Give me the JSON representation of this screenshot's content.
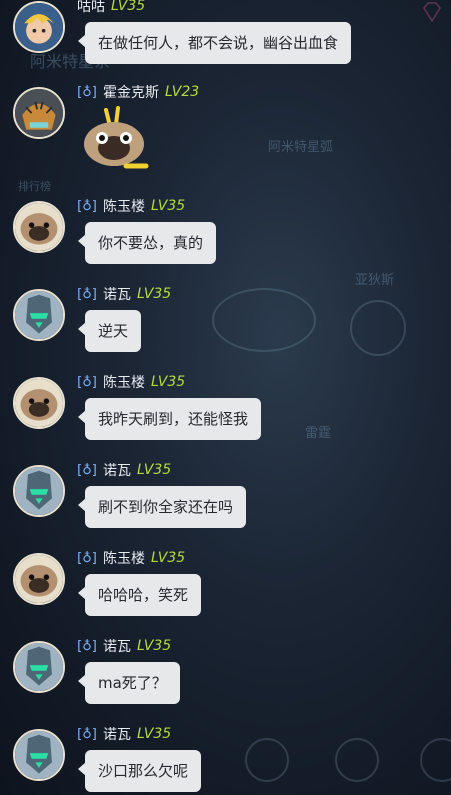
{
  "background": {
    "map_label_1": "阿米特星弧",
    "map_label_2": "亚狄斯",
    "map_label_3": "雷霆",
    "map_label_4": "排行榜",
    "map_label_5": "阿米特星系"
  },
  "messages": [
    {
      "name": "咕咕",
      "level": "LV35",
      "text": "在做任何人，都不会说，幽谷出血食",
      "avatar": "blonde-warrior-avatar",
      "vip": false
    },
    {
      "name": "霍金克斯",
      "level": "LV23",
      "text": "",
      "sticker": "pug-sticker",
      "avatar": "tiger-mech-avatar",
      "vip": true
    },
    {
      "name": "陈玉楼",
      "level": "LV35",
      "text": "你不要怂，真的",
      "avatar": "pug-avatar",
      "vip": true
    },
    {
      "name": "诺瓦",
      "level": "LV35",
      "text": "逆天",
      "avatar": "cyber-knight-avatar",
      "vip": true
    },
    {
      "name": "陈玉楼",
      "level": "LV35",
      "text": "我昨天刷到，还能怪我",
      "avatar": "pug-avatar",
      "vip": true
    },
    {
      "name": "诺瓦",
      "level": "LV35",
      "text": "刷不到你全家还在吗",
      "avatar": "cyber-knight-avatar",
      "vip": true
    },
    {
      "name": "陈玉楼",
      "level": "LV35",
      "text": "哈哈哈，笑死",
      "avatar": "pug-avatar",
      "vip": true
    },
    {
      "name": "诺瓦",
      "level": "LV35",
      "text": "ma死了？",
      "avatar": "cyber-knight-avatar",
      "vip": true
    },
    {
      "name": "诺瓦",
      "level": "LV35",
      "text": "沙口那么欠呢",
      "avatar": "cyber-knight-avatar",
      "vip": true
    }
  ],
  "colors": {
    "level": "#b6dd37",
    "bubble": "#e6e8ea",
    "vip_badge": "#7fb3ff"
  }
}
